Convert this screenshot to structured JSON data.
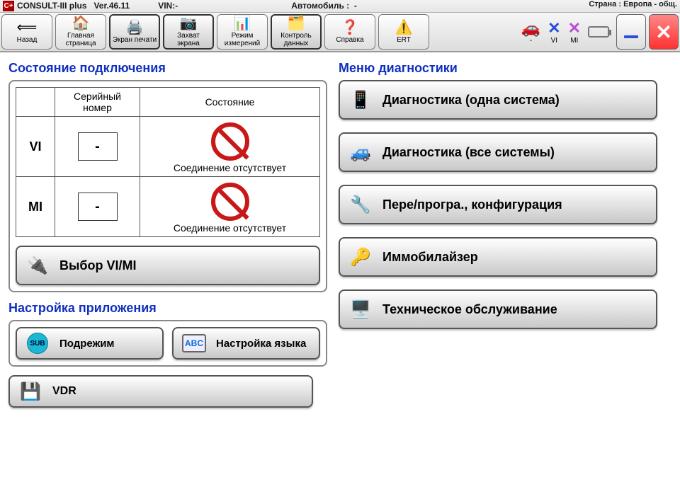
{
  "infobar": {
    "logo": "C+",
    "app": "CONSULT-III plus",
    "version": "Ver.46.11",
    "vin_label": "VIN:",
    "vin_value": "-",
    "vehicle_label": "Автомобиль :",
    "vehicle_value": "-",
    "country_label": "Страна :",
    "country_value": "Европа - общ."
  },
  "toolbar": {
    "back": "Назад",
    "home": "Главная страница",
    "print": "Экран печати",
    "capture": "Захват экрана",
    "measure": "Режим измерений",
    "recorded": "Контроль данных",
    "help": "Справка",
    "ert": "ERT"
  },
  "status": {
    "vi": "VI",
    "mi": "MI",
    "car": "-"
  },
  "left": {
    "conn_title": "Состояние подключения",
    "serial_header": "Серийный номер",
    "state_header": "Состояние",
    "rows": [
      {
        "label": "VI",
        "serial": "-",
        "state": "Соединение отсутствует"
      },
      {
        "label": "MI",
        "serial": "-",
        "state": "Соединение отсутствует"
      }
    ],
    "select_vimi": "Выбор VI/MI",
    "app_settings_title": "Настройка приложения",
    "sub_mode": "Подрежим",
    "sub_badge": "SUB",
    "lang": "Настройка языка",
    "abc": "ABC",
    "vdr": "VDR"
  },
  "right": {
    "menu_title": "Меню диагностики",
    "diag_one": "Диагностика (одна система)",
    "diag_all": "Диагностика (все системы)",
    "reprog": "Пере/програ., конфигурация",
    "immo": "Иммобилайзер",
    "maint": "Техническое обслуживание"
  }
}
